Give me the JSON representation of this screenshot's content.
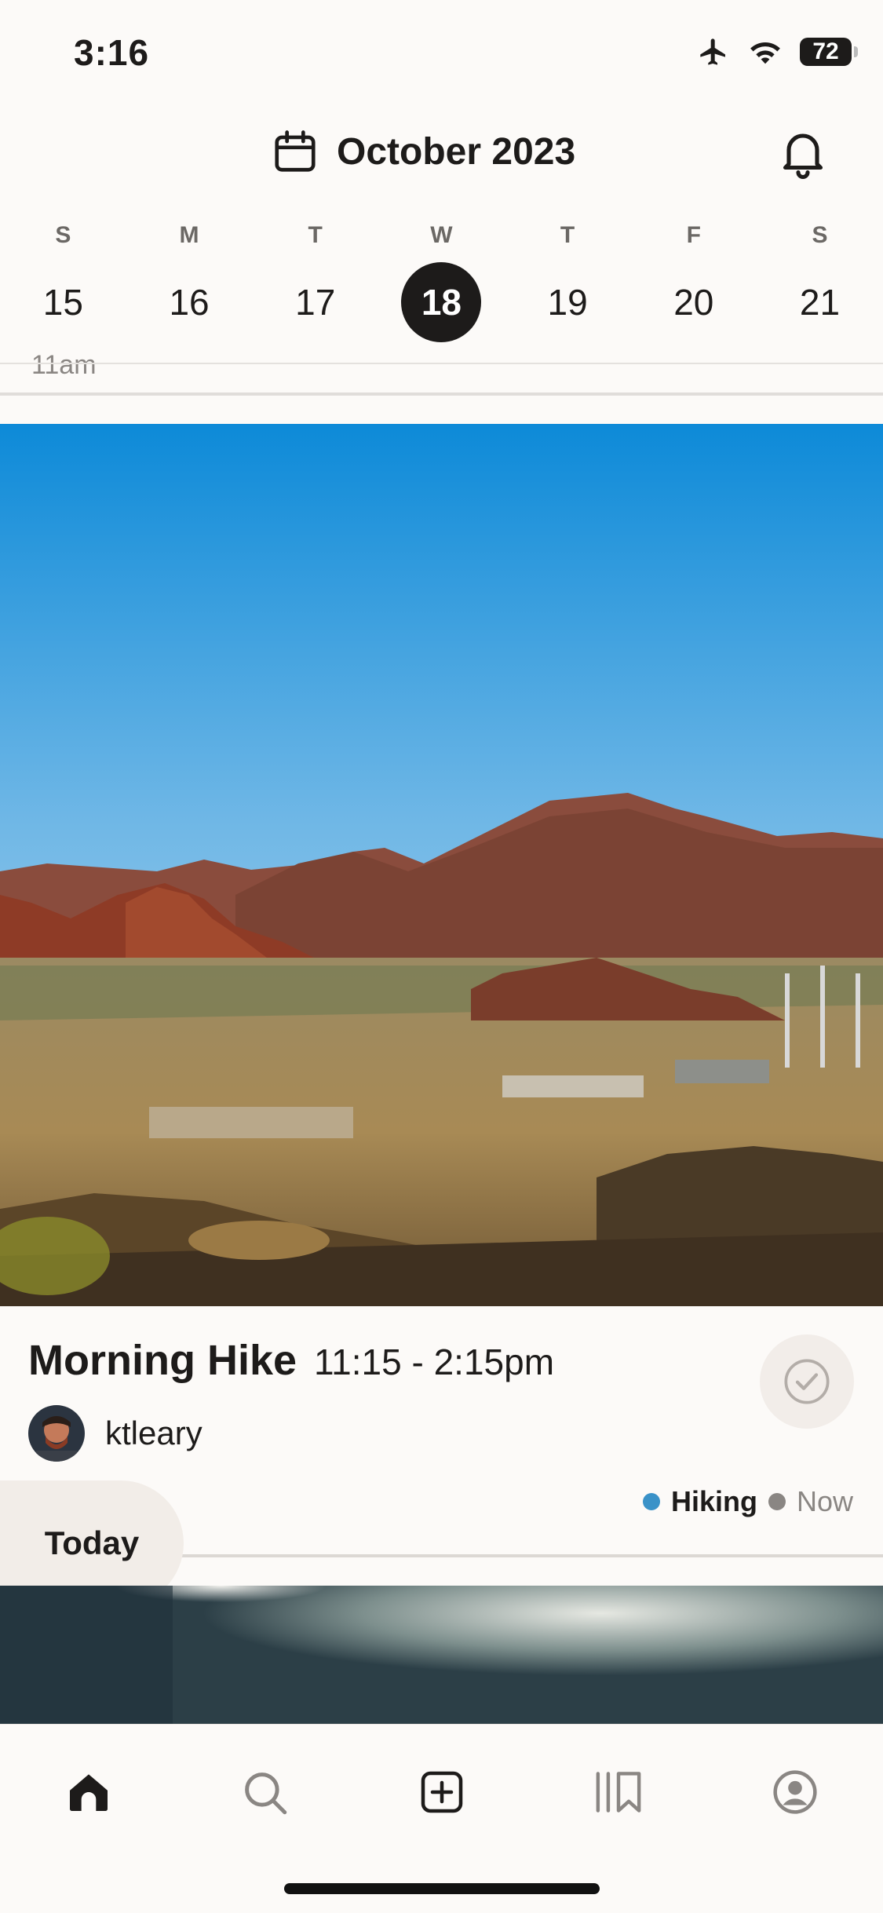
{
  "status_bar": {
    "time": "3:16",
    "battery": "72"
  },
  "header": {
    "month_title": "October 2023"
  },
  "week": {
    "weekdays": [
      "S",
      "M",
      "T",
      "W",
      "T",
      "F",
      "S"
    ],
    "dates": [
      "15",
      "16",
      "17",
      "18",
      "19",
      "20",
      "21"
    ],
    "selected_date": "18"
  },
  "peek": {
    "label": "11am"
  },
  "event": {
    "title": "Morning Hike",
    "time": "11:15 - 2:15pm",
    "username": "ktleary",
    "tags": [
      {
        "label": "Hiking",
        "color": "#3a92c8"
      },
      {
        "label": "Now",
        "color": "#8a8683"
      }
    ]
  },
  "today_button": {
    "label": "Today"
  },
  "tab_bar": {
    "items": [
      "home-icon",
      "search-icon",
      "add-icon",
      "library-icon",
      "profile-icon"
    ],
    "active": "home-icon"
  }
}
